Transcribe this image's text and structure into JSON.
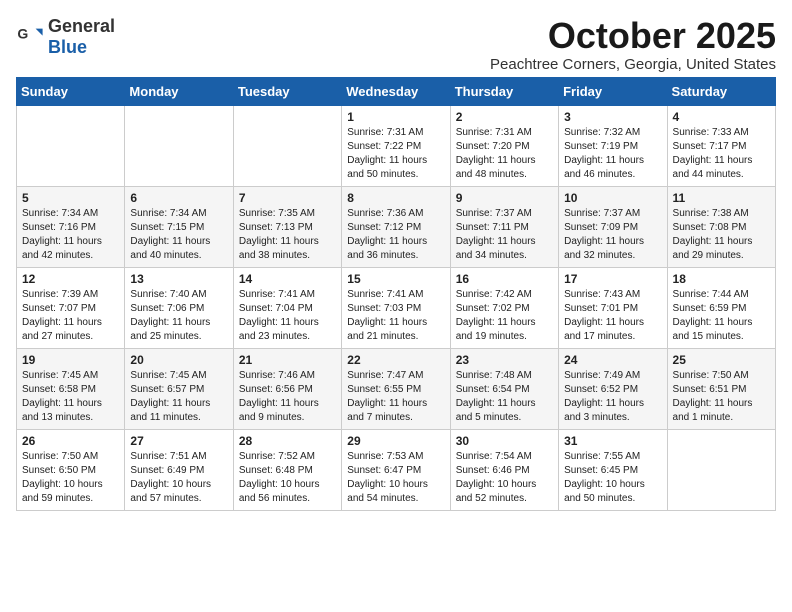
{
  "header": {
    "logo_general": "General",
    "logo_blue": "Blue",
    "title": "October 2025",
    "subtitle": "Peachtree Corners, Georgia, United States"
  },
  "columns": [
    "Sunday",
    "Monday",
    "Tuesday",
    "Wednesday",
    "Thursday",
    "Friday",
    "Saturday"
  ],
  "weeks": [
    [
      {
        "day": "",
        "info": ""
      },
      {
        "day": "",
        "info": ""
      },
      {
        "day": "",
        "info": ""
      },
      {
        "day": "1",
        "info": "Sunrise: 7:31 AM\nSunset: 7:22 PM\nDaylight: 11 hours\nand 50 minutes."
      },
      {
        "day": "2",
        "info": "Sunrise: 7:31 AM\nSunset: 7:20 PM\nDaylight: 11 hours\nand 48 minutes."
      },
      {
        "day": "3",
        "info": "Sunrise: 7:32 AM\nSunset: 7:19 PM\nDaylight: 11 hours\nand 46 minutes."
      },
      {
        "day": "4",
        "info": "Sunrise: 7:33 AM\nSunset: 7:17 PM\nDaylight: 11 hours\nand 44 minutes."
      }
    ],
    [
      {
        "day": "5",
        "info": "Sunrise: 7:34 AM\nSunset: 7:16 PM\nDaylight: 11 hours\nand 42 minutes."
      },
      {
        "day": "6",
        "info": "Sunrise: 7:34 AM\nSunset: 7:15 PM\nDaylight: 11 hours\nand 40 minutes."
      },
      {
        "day": "7",
        "info": "Sunrise: 7:35 AM\nSunset: 7:13 PM\nDaylight: 11 hours\nand 38 minutes."
      },
      {
        "day": "8",
        "info": "Sunrise: 7:36 AM\nSunset: 7:12 PM\nDaylight: 11 hours\nand 36 minutes."
      },
      {
        "day": "9",
        "info": "Sunrise: 7:37 AM\nSunset: 7:11 PM\nDaylight: 11 hours\nand 34 minutes."
      },
      {
        "day": "10",
        "info": "Sunrise: 7:37 AM\nSunset: 7:09 PM\nDaylight: 11 hours\nand 32 minutes."
      },
      {
        "day": "11",
        "info": "Sunrise: 7:38 AM\nSunset: 7:08 PM\nDaylight: 11 hours\nand 29 minutes."
      }
    ],
    [
      {
        "day": "12",
        "info": "Sunrise: 7:39 AM\nSunset: 7:07 PM\nDaylight: 11 hours\nand 27 minutes."
      },
      {
        "day": "13",
        "info": "Sunrise: 7:40 AM\nSunset: 7:06 PM\nDaylight: 11 hours\nand 25 minutes."
      },
      {
        "day": "14",
        "info": "Sunrise: 7:41 AM\nSunset: 7:04 PM\nDaylight: 11 hours\nand 23 minutes."
      },
      {
        "day": "15",
        "info": "Sunrise: 7:41 AM\nSunset: 7:03 PM\nDaylight: 11 hours\nand 21 minutes."
      },
      {
        "day": "16",
        "info": "Sunrise: 7:42 AM\nSunset: 7:02 PM\nDaylight: 11 hours\nand 19 minutes."
      },
      {
        "day": "17",
        "info": "Sunrise: 7:43 AM\nSunset: 7:01 PM\nDaylight: 11 hours\nand 17 minutes."
      },
      {
        "day": "18",
        "info": "Sunrise: 7:44 AM\nSunset: 6:59 PM\nDaylight: 11 hours\nand 15 minutes."
      }
    ],
    [
      {
        "day": "19",
        "info": "Sunrise: 7:45 AM\nSunset: 6:58 PM\nDaylight: 11 hours\nand 13 minutes."
      },
      {
        "day": "20",
        "info": "Sunrise: 7:45 AM\nSunset: 6:57 PM\nDaylight: 11 hours\nand 11 minutes."
      },
      {
        "day": "21",
        "info": "Sunrise: 7:46 AM\nSunset: 6:56 PM\nDaylight: 11 hours\nand 9 minutes."
      },
      {
        "day": "22",
        "info": "Sunrise: 7:47 AM\nSunset: 6:55 PM\nDaylight: 11 hours\nand 7 minutes."
      },
      {
        "day": "23",
        "info": "Sunrise: 7:48 AM\nSunset: 6:54 PM\nDaylight: 11 hours\nand 5 minutes."
      },
      {
        "day": "24",
        "info": "Sunrise: 7:49 AM\nSunset: 6:52 PM\nDaylight: 11 hours\nand 3 minutes."
      },
      {
        "day": "25",
        "info": "Sunrise: 7:50 AM\nSunset: 6:51 PM\nDaylight: 11 hours\nand 1 minute."
      }
    ],
    [
      {
        "day": "26",
        "info": "Sunrise: 7:50 AM\nSunset: 6:50 PM\nDaylight: 10 hours\nand 59 minutes."
      },
      {
        "day": "27",
        "info": "Sunrise: 7:51 AM\nSunset: 6:49 PM\nDaylight: 10 hours\nand 57 minutes."
      },
      {
        "day": "28",
        "info": "Sunrise: 7:52 AM\nSunset: 6:48 PM\nDaylight: 10 hours\nand 56 minutes."
      },
      {
        "day": "29",
        "info": "Sunrise: 7:53 AM\nSunset: 6:47 PM\nDaylight: 10 hours\nand 54 minutes."
      },
      {
        "day": "30",
        "info": "Sunrise: 7:54 AM\nSunset: 6:46 PM\nDaylight: 10 hours\nand 52 minutes."
      },
      {
        "day": "31",
        "info": "Sunrise: 7:55 AM\nSunset: 6:45 PM\nDaylight: 10 hours\nand 50 minutes."
      },
      {
        "day": "",
        "info": ""
      }
    ]
  ]
}
